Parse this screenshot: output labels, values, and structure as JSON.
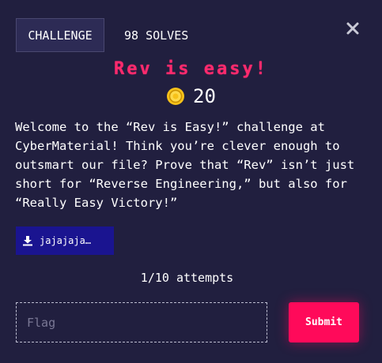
{
  "header": {
    "challenge_tab": "CHALLENGE",
    "solves_tab": "98 SOLVES",
    "close_icon": "close-icon"
  },
  "challenge": {
    "title": "Rev is easy!",
    "points_icon": "coin-icon",
    "points": "20",
    "description": "Welcome to the “Rev is Easy!” challenge at CyberMaterial! Think you’re clever enough to outsmart our file? Prove that “Rev” isn’t just short for “Reverse Engineering,” but also for “Really Easy Victory!”",
    "file": {
      "icon": "download-icon",
      "label": "jajajaja…"
    },
    "attempts": "1/10 attempts"
  },
  "form": {
    "flag_placeholder": "Flag",
    "flag_value": "",
    "submit_label": "Submit"
  },
  "colors": {
    "background": "#211f3f",
    "accent": "#ff2a6d",
    "submit": "#ff0a5a",
    "file_button": "#1a1490",
    "coin": "#f7c21a"
  }
}
